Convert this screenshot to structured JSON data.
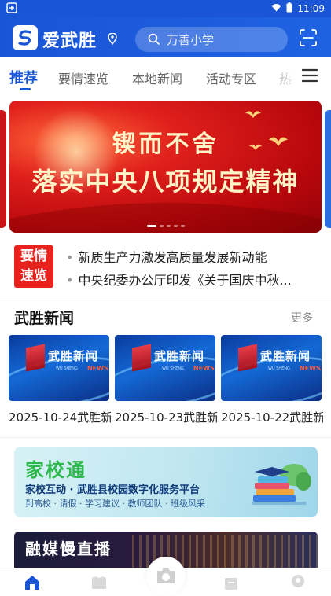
{
  "status_bar": {
    "time": "11:09"
  },
  "header": {
    "brand": "爱武胜",
    "search_placeholder": "万善小学"
  },
  "tabs": [
    {
      "label": "推荐",
      "active": true
    },
    {
      "label": "要情速览"
    },
    {
      "label": "本地新闻"
    },
    {
      "label": "活动专区"
    },
    {
      "label": "热"
    }
  ],
  "banner": {
    "line1": "锲而不舍",
    "line2": "落实中央八项规定精神"
  },
  "quick_news": {
    "badge": "要情速览",
    "items": [
      "新质生产力激发高质量发展新动能",
      "中央纪委办公厅印发《关于国庆中秋..."
    ]
  },
  "news_section": {
    "title": "武胜新闻",
    "more": "更多",
    "thumb_title": "武胜新闻",
    "thumb_news": "NEWS",
    "thumb_sub": "WU SHENG",
    "cards": [
      {
        "caption": "2025-10-24武胜新"
      },
      {
        "caption": "2025-10-23武胜新"
      },
      {
        "caption": "2025-10-22武胜新"
      }
    ]
  },
  "promo": {
    "title": "家校通",
    "subtitle": "家校互动 · 武胜县校园数字化服务平台",
    "tags": "到高校 · 请假 · 学习建议 · 教师团队 · 班级风采"
  },
  "live": {
    "title": "融媒慢直播"
  },
  "colors": {
    "primary": "#1a55d6",
    "badge_red": "#e8231d"
  }
}
